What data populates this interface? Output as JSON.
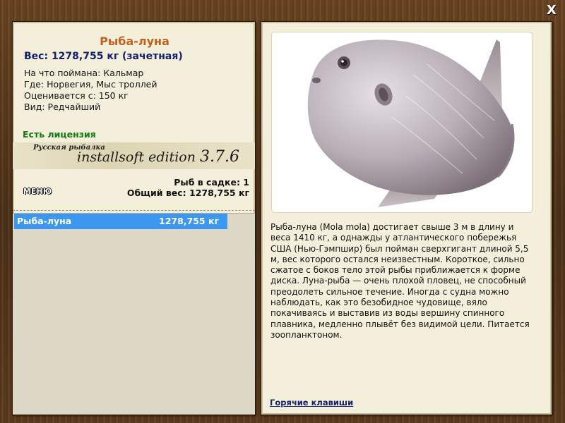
{
  "window": {
    "close_label": "X"
  },
  "fish": {
    "title": "Рыба-луна",
    "weight": "Вес: 1278,755 кг (зачетная)",
    "details": [
      "На что поймана: Кальмар",
      "Где: Норвегия, Мыс троллей",
      "Оценивается с: 150 кг",
      "Вид: Редчайший"
    ],
    "license": "Есть лицензия"
  },
  "edition": {
    "small": "Русская рыбалка",
    "main": "installsoft edition",
    "version": "3.7.6"
  },
  "stats": {
    "fish_count": "Рыб в садке: 1",
    "total_weight": "Общий вес: 1278,755 кг"
  },
  "menu_label": "МЕНЮ",
  "catch_list": [
    {
      "name": "Рыба-луна",
      "weight": "1278,755 кг"
    }
  ],
  "description": "Рыба-луна (Mola mola) достигает свыше 3 м в длину и веса 1410 кг, а однажды у атлантического побережья США (Нью-Гэмпшир) был пойман сверхгигант длиной 5,5 м, вес которого остался неизвестным. Короткое, сильно сжатое с боков тело этой рыбы приближается к форме диска. Луна-рыба — очень плохой пловец, не способный преодолеть сильное течение. Иногда с судна можно наблюдать, как это безобидное чудовище, вяло покачиваясь и выставив из воды вершину спинного плавника, медленно плывёт без видимой цели. Питается зоопланктоном.",
  "hotkeys_label": "Горячие клавиши",
  "colors": {
    "title": "#c0621d",
    "weight": "#15206c",
    "license": "#117a11",
    "selection": "#3b97ef"
  }
}
